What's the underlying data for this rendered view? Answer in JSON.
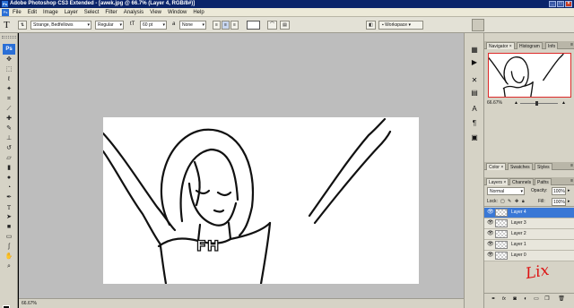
{
  "title_bar": {
    "app_icon": "Ps",
    "title": "Adobe Photoshop CS3 Extended - [awek.jpg @ 66.7% (Layer 4, RGB/8#)]",
    "buttons": [
      "minimize-icon",
      "maximize-icon",
      "close-icon"
    ]
  },
  "menu_bar": {
    "logo": "Ps",
    "items": [
      "File",
      "Edit",
      "Image",
      "Layer",
      "Select",
      "Filter",
      "Analysis",
      "View",
      "Window",
      "Help"
    ]
  },
  "options_bar": {
    "tool_glyph": "T",
    "font_family": "Strange, Bedfellows",
    "font_style": "Regular",
    "size_glyph": "tT",
    "font_size": "60 pt",
    "aa_label": "a",
    "antialias": "None",
    "align": [
      "align-left-icon",
      "align-center-icon",
      "align-right-icon"
    ],
    "workspace_label": "Workspace"
  },
  "toolbox": {
    "badge": "Ps",
    "tools": [
      "move-icon",
      "marquee-icon",
      "lasso-icon",
      "magic-wand-icon",
      "crop-icon",
      "slice-icon",
      "healing-icon",
      "brush-icon",
      "stamp-icon",
      "history-brush-icon",
      "eraser-icon",
      "gradient-icon",
      "blur-icon",
      "dodge-icon",
      "pen-icon",
      "type-icon",
      "path-select-icon",
      "shape-icon",
      "notes-icon",
      "eyedropper-icon",
      "hand-icon",
      "zoom-icon"
    ],
    "foreground_color": "#000000",
    "background_color": "#ffffff"
  },
  "document": {
    "lettering": "FH"
  },
  "status_bar": {
    "zoom": "66.67%"
  },
  "navigator_panel": {
    "tabs": [
      "Navigator",
      "Histogram",
      "Info"
    ],
    "zoom": "66.67%"
  },
  "color_panel": {
    "tabs": [
      "Color",
      "Swatches",
      "Styles"
    ]
  },
  "layers_panel": {
    "tabs": [
      "Layers",
      "Channels",
      "Paths"
    ],
    "blend_mode": "Normal",
    "opacity_label": "Opacity:",
    "opacity": "100%",
    "lock_label": "Lock:",
    "fill_label": "Fill:",
    "fill": "100%",
    "layers": [
      {
        "name": "Layer 4",
        "selected": true
      },
      {
        "name": "Layer 3",
        "selected": false
      },
      {
        "name": "Layer 2",
        "selected": false
      },
      {
        "name": "Layer 1",
        "selected": false
      },
      {
        "name": "Layer 0",
        "selected": false
      }
    ],
    "bottom_icons": [
      "link-icon",
      "fx-icon",
      "mask-icon",
      "adjustment-icon",
      "group-icon",
      "new-layer-icon",
      "trash-icon"
    ]
  },
  "annotation": {
    "text": "Lix",
    "color": "#dd1111"
  },
  "colors": {
    "selection": "#3a78d6",
    "navigator_frame": "#dd2a2a",
    "title_bar": "#0a246a"
  }
}
